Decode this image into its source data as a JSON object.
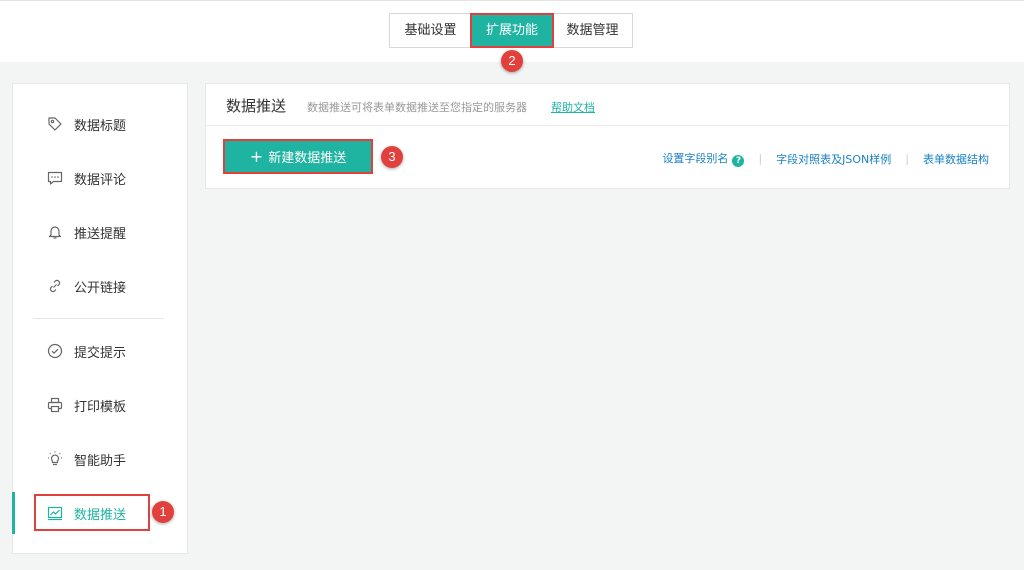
{
  "top_tabs": [
    {
      "label": "基础设置"
    },
    {
      "label": "扩展功能",
      "active": true
    },
    {
      "label": "数据管理"
    }
  ],
  "markers": {
    "m1": "1",
    "m2": "2",
    "m3": "3"
  },
  "sidebar": {
    "items": [
      {
        "label": "数据标题",
        "icon": "tag-icon"
      },
      {
        "label": "数据评论",
        "icon": "comment-icon"
      },
      {
        "label": "推送提醒",
        "icon": "bell-icon"
      },
      {
        "label": "公开链接",
        "icon": "link-icon"
      },
      {
        "label": "提交提示",
        "icon": "check-circle-icon"
      },
      {
        "label": "打印模板",
        "icon": "printer-icon"
      },
      {
        "label": "智能助手",
        "icon": "lightbulb-icon"
      },
      {
        "label": "数据推送",
        "icon": "chart-icon",
        "active": true
      }
    ]
  },
  "panel": {
    "title": "数据推送",
    "description": "数据推送可将表单数据推送至您指定的服务器",
    "help_link": "帮助文档",
    "new_button": "新建数据推送",
    "links": {
      "alias": "设置字段别名",
      "mapping": "字段对照表及JSON样例",
      "structure": "表单数据结构",
      "separator": "|"
    }
  },
  "colors": {
    "accent": "#1fb3a1",
    "highlight": "#e0413d",
    "link": "#1a82c4"
  }
}
